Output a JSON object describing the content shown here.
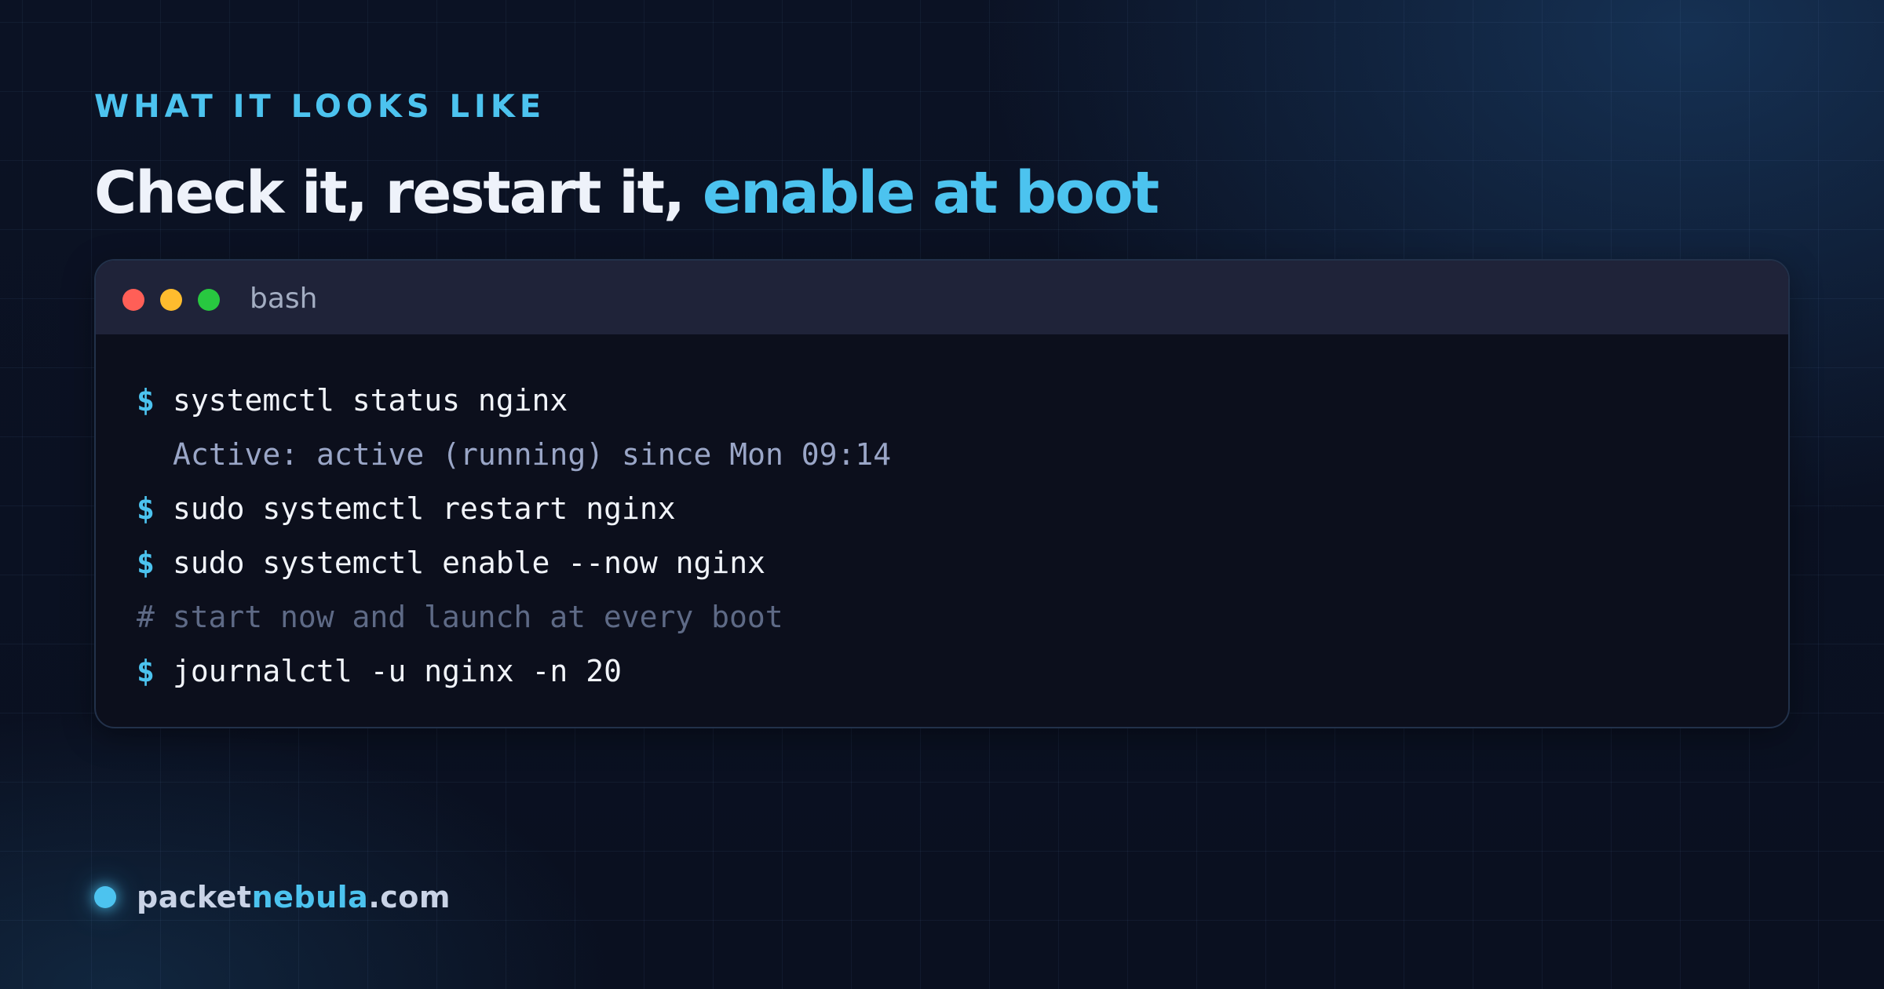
{
  "eyebrow": "WHAT IT LOOKS LIKE",
  "headline": {
    "main": "Check it, restart it, ",
    "accent": "enable at boot"
  },
  "terminal": {
    "tab_label": "bash",
    "lines": [
      {
        "kind": "command",
        "prompt": "$",
        "text": "systemctl status nginx"
      },
      {
        "kind": "output",
        "text": "Active: active (running) since Mon 09:14"
      },
      {
        "kind": "command",
        "prompt": "$",
        "text": "sudo systemctl restart nginx"
      },
      {
        "kind": "command",
        "prompt": "$",
        "text": "sudo systemctl enable --now nginx"
      },
      {
        "kind": "comment",
        "text": "# start now and launch at every boot"
      },
      {
        "kind": "command",
        "prompt": "$",
        "text": "journalctl -u nginx -n 20"
      }
    ]
  },
  "brand": {
    "part1": "packet",
    "part2": "nebula",
    "part3": ".com"
  },
  "colors": {
    "accent": "#4cc3ef",
    "background": "#0a1020",
    "terminal_bg": "#0c0f1c",
    "titlebar_bg": "#1f2339",
    "close": "#ff5f57",
    "minimize": "#febc2e",
    "maximize": "#28c840"
  }
}
